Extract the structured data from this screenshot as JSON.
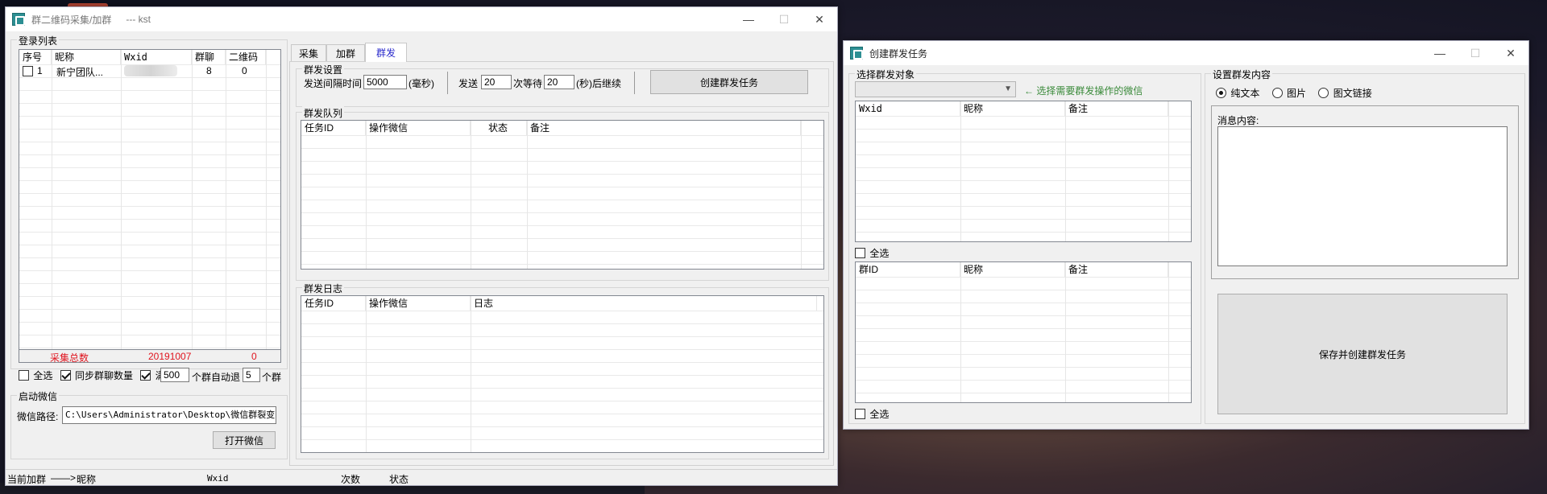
{
  "main_window": {
    "title": "群二维码采集/加群",
    "subtitle": "--- kst",
    "login_list": {
      "label": "登录列表",
      "columns": [
        "序号",
        "昵称",
        "Wxid",
        "群聊",
        "二维码"
      ],
      "rows": [
        {
          "index": "1",
          "nickname": "新宁团队...",
          "wxid": "",
          "groups": "8",
          "qrcodes": "0"
        }
      ],
      "footer": {
        "label": "采集总数",
        "date": "20191007",
        "count": "0"
      }
    },
    "options": {
      "select_all": "全选",
      "sync_group_count": "同步群聊数量",
      "full_prefix": "满",
      "full_value": "500",
      "auto_exit_label": "个群自动退",
      "auto_exit_value": "5",
      "groups_suffix": "个群"
    },
    "wechat_launch": {
      "label": "启动微信",
      "path_label": "微信路径:",
      "path_value": "C:\\Users\\Administrator\\Desktop\\微信群裂变\\微",
      "open_button": "打开微信"
    },
    "tabs": [
      "采集",
      "加群",
      "群发"
    ],
    "active_tab": "群发",
    "mass_settings": {
      "label": "群发设置",
      "interval_label": "发送间隔时间",
      "interval_value": "5000",
      "interval_unit": "(毫秒)",
      "send_label": "发送",
      "send_value": "20",
      "wait_label": "次等待",
      "wait_value": "20",
      "continue_label": "(秒)后继续",
      "create_button": "创建群发任务"
    },
    "queue": {
      "label": "群发队列",
      "columns": [
        "任务ID",
        "操作微信",
        "状态",
        "备注"
      ]
    },
    "log": {
      "label": "群发日志",
      "columns": [
        "任务ID",
        "操作微信",
        "日志"
      ]
    },
    "status_bar": {
      "current_label": "当前加群",
      "arrow": "——>",
      "nickname": "昵称",
      "wxid": "Wxid",
      "count": "次数",
      "state": "状态"
    }
  },
  "task_window": {
    "title": "创建群发任务",
    "target": {
      "label": "选择群发对象",
      "hint": "← 选择需要群发操作的微信",
      "top_columns": [
        "Wxid",
        "昵称",
        "备注"
      ],
      "select_all_1": "全选",
      "bottom_columns": [
        "群ID",
        "昵称",
        "备注"
      ],
      "select_all_2": "全选"
    },
    "content": {
      "label": "设置群发内容",
      "options": [
        "纯文本",
        "图片",
        "图文链接"
      ],
      "selected": "纯文本",
      "message_label": "消息内容:",
      "save_button": "保存并创建群发任务"
    }
  },
  "window_controls": {
    "minimize": "—",
    "maximize": "☐",
    "close": "✕"
  }
}
